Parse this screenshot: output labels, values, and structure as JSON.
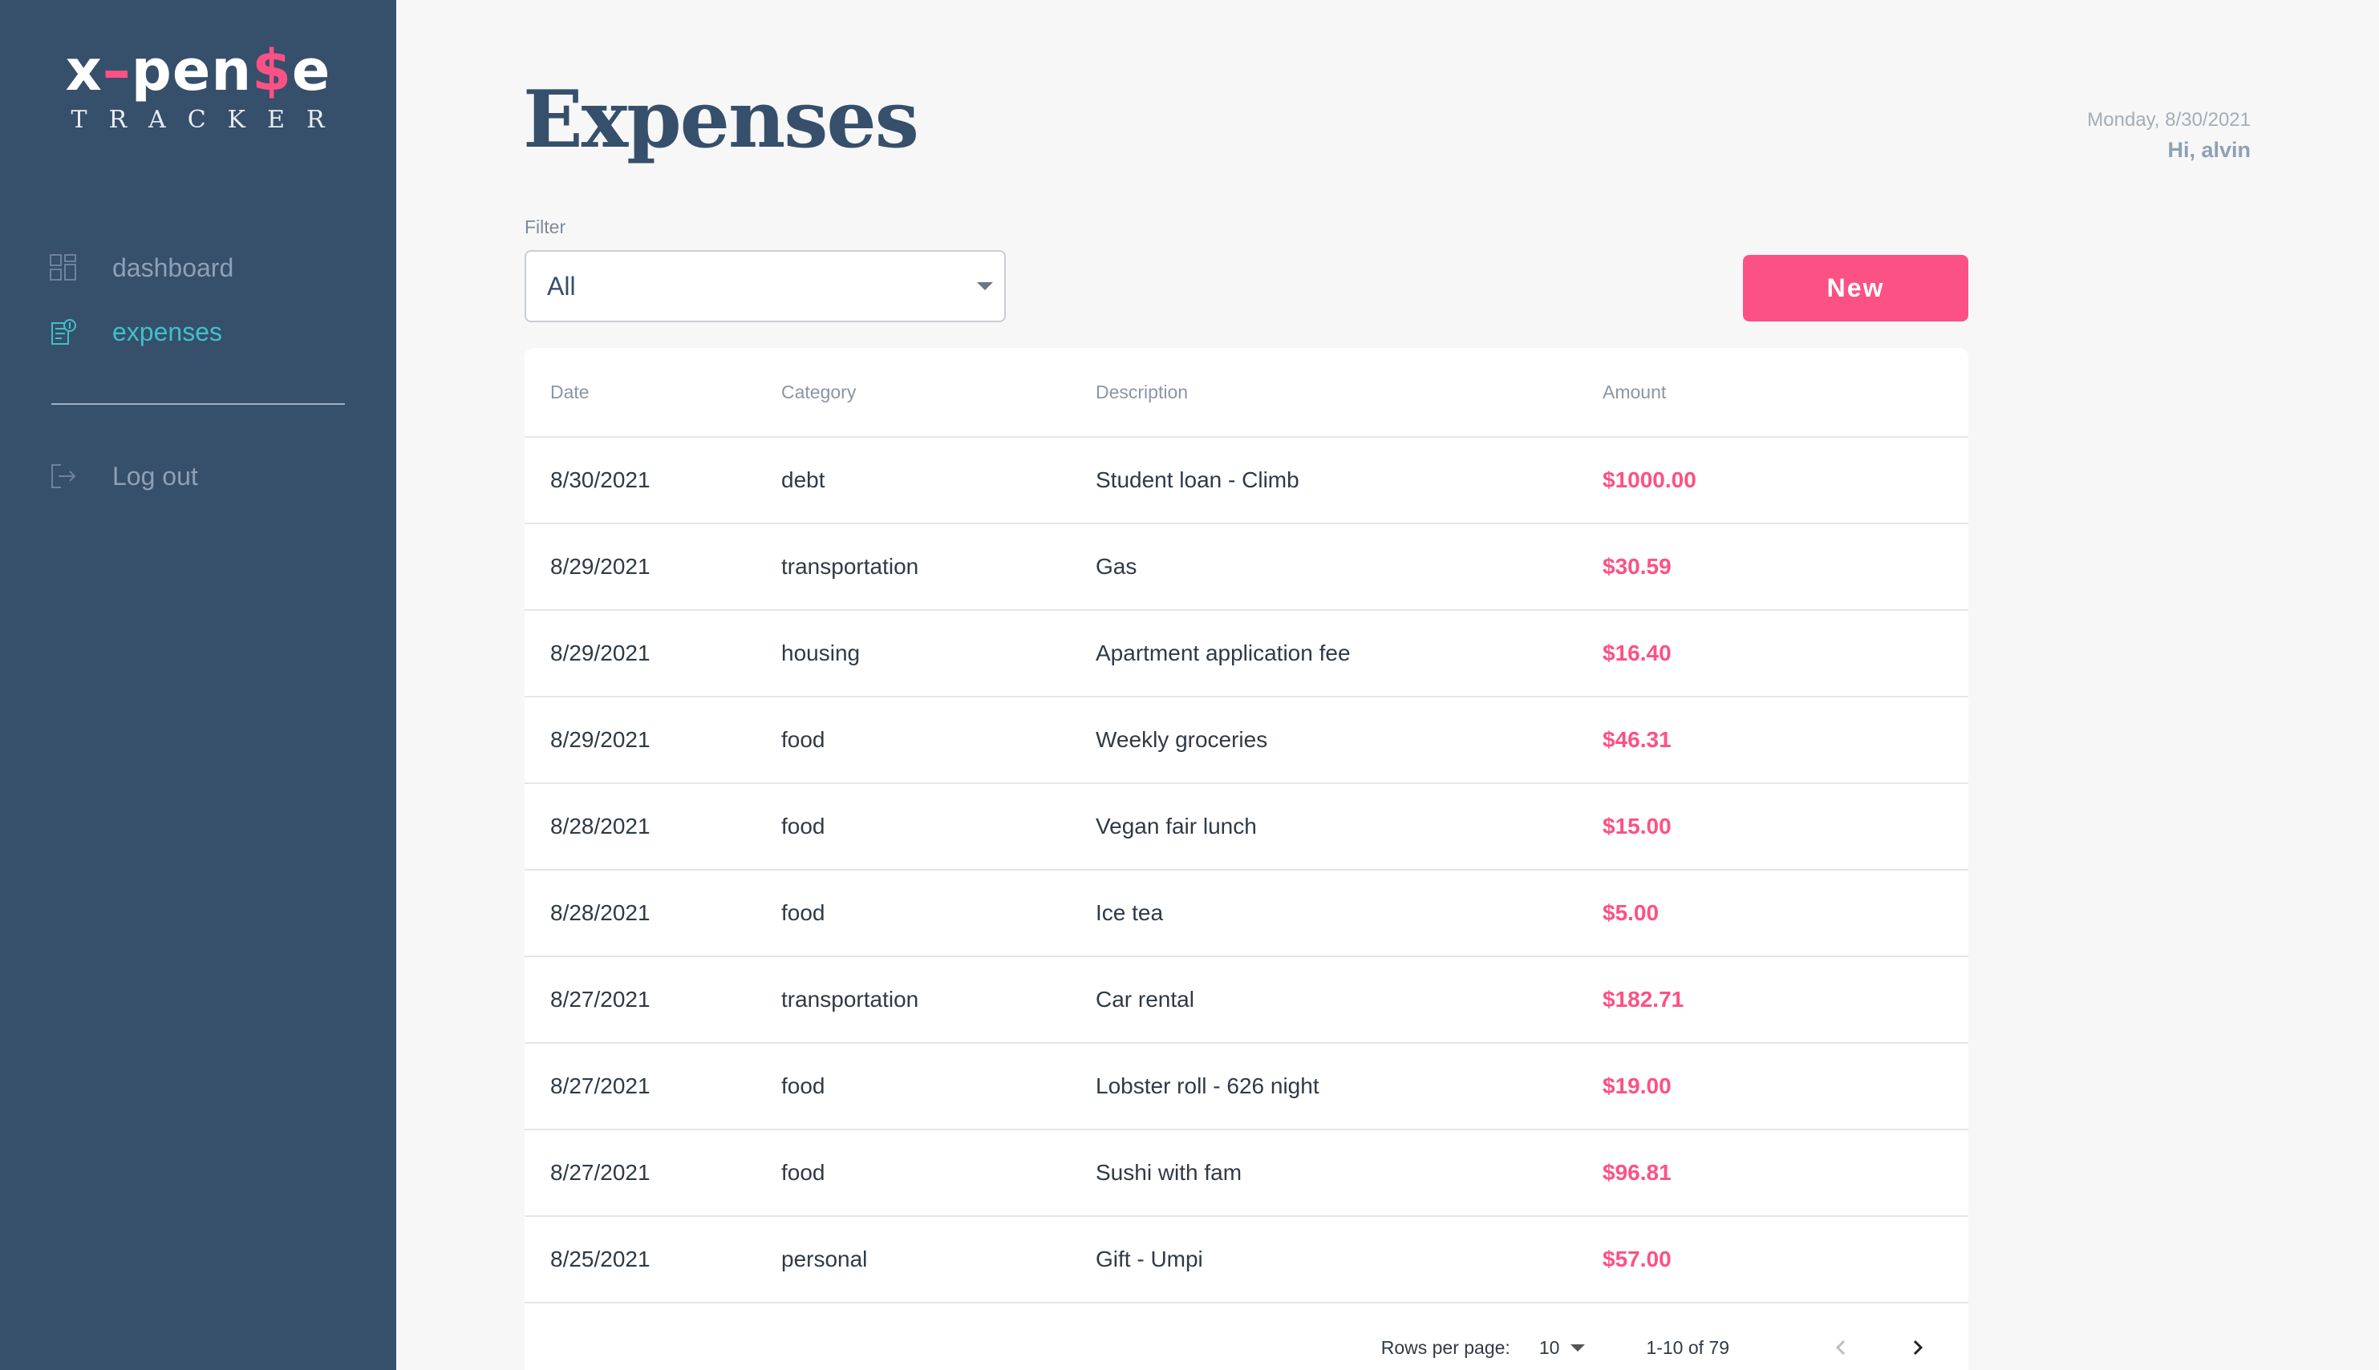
{
  "brand": {
    "logo_part1": "x",
    "logo_dash": "–",
    "logo_part2": "pen",
    "logo_dollar": "$",
    "logo_part3": "e",
    "subtitle": "TRACKER",
    "accent_color": "#fc5185"
  },
  "sidebar": {
    "background": "#364f6b",
    "items": [
      {
        "label": "dashboard",
        "icon": "dashboard-icon",
        "active": false
      },
      {
        "label": "expenses",
        "icon": "receipt-icon",
        "active": true
      }
    ],
    "logout_label": "Log out"
  },
  "header": {
    "title": "Expenses",
    "date": "Monday, 8/30/2021",
    "greeting": "Hi, alvin"
  },
  "filter": {
    "label": "Filter",
    "value": "All"
  },
  "new_button": {
    "label": "New"
  },
  "table": {
    "columns": [
      "Date",
      "Category",
      "Description",
      "Amount"
    ],
    "rows": [
      {
        "date": "8/30/2021",
        "category": "debt",
        "description": "Student loan - Climb",
        "amount": "$1000.00"
      },
      {
        "date": "8/29/2021",
        "category": "transportation",
        "description": "Gas",
        "amount": "$30.59"
      },
      {
        "date": "8/29/2021",
        "category": "housing",
        "description": "Apartment application fee",
        "amount": "$16.40"
      },
      {
        "date": "8/29/2021",
        "category": "food",
        "description": "Weekly groceries",
        "amount": "$46.31"
      },
      {
        "date": "8/28/2021",
        "category": "food",
        "description": "Vegan fair lunch",
        "amount": "$15.00"
      },
      {
        "date": "8/28/2021",
        "category": "food",
        "description": "Ice tea",
        "amount": "$5.00"
      },
      {
        "date": "8/27/2021",
        "category": "transportation",
        "description": "Car rental",
        "amount": "$182.71"
      },
      {
        "date": "8/27/2021",
        "category": "food",
        "description": "Lobster roll - 626 night",
        "amount": "$19.00"
      },
      {
        "date": "8/27/2021",
        "category": "food",
        "description": "Sushi with fam",
        "amount": "$96.81"
      },
      {
        "date": "8/25/2021",
        "category": "personal",
        "description": "Gift - Umpi",
        "amount": "$57.00"
      }
    ]
  },
  "pagination": {
    "rows_per_page_label": "Rows per page:",
    "rows_per_page": "10",
    "range": "1-10 of 79"
  }
}
